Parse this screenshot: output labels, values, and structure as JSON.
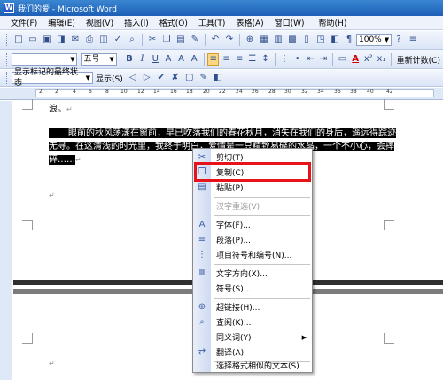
{
  "window": {
    "title": "我们的爱 - Microsoft Word",
    "app_icon": "word-icon"
  },
  "menu": [
    "文件(F)",
    "编辑(E)",
    "视图(V)",
    "插入(I)",
    "格式(O)",
    "工具(T)",
    "表格(A)",
    "窗口(W)",
    "帮助(H)"
  ],
  "toolbar1": {
    "zoom": "100%"
  },
  "toolbar2": {
    "font_size": "五号",
    "bold": "B",
    "italic": "I",
    "underline": "U",
    "font_color": "A",
    "superscript": "x²",
    "subscript": "x₁",
    "word_count": "重新计数(C)"
  },
  "toolbar3": {
    "view_mode": "显示标记的最终状态",
    "show": "显示(S)"
  },
  "ruler": {
    "ticks": [
      "2",
      "2",
      "4",
      "6",
      "8",
      "10",
      "12",
      "14",
      "16",
      "18",
      "20",
      "22",
      "24",
      "26",
      "28",
      "30",
      "32",
      "34",
      "36",
      "38",
      "40",
      "42"
    ]
  },
  "document": {
    "line0": "浪。",
    "line1": "眼前的秋风荡漾在窗前，早已吹落我们的春花秋月，消失在我们的身后，遥远得踪迹",
    "line2": "无寻。在这清浅的时光里，我终于明白，",
    "line2_tail": "爱情是一只精致易碎的水晶，一个不小心，会摔",
    "line3": "碎……"
  },
  "context_menu": {
    "items": [
      {
        "label": "剪切(T)",
        "icon": "scissors-icon"
      },
      {
        "label": "复制(C)",
        "icon": "copy-icon"
      },
      {
        "label": "粘贴(P)",
        "icon": "paste-icon"
      },
      {
        "label": "汉字重选(V)",
        "icon": ""
      },
      {
        "label": "字体(F)...",
        "icon": "font-icon"
      },
      {
        "label": "段落(P)...",
        "icon": "paragraph-icon"
      },
      {
        "label": "项目符号和编号(N)...",
        "icon": "bullets-icon"
      },
      {
        "label": "文字方向(X)...",
        "icon": "text-direction-icon"
      },
      {
        "label": "符号(S)...",
        "icon": ""
      },
      {
        "label": "超链接(H)...",
        "icon": "hyperlink-icon"
      },
      {
        "label": "查阅(K)...",
        "icon": "lookup-icon"
      },
      {
        "label": "同义词(Y)",
        "icon": ""
      },
      {
        "label": "翻译(A)",
        "icon": "translate-icon"
      },
      {
        "label": "选择格式相似的文本(S)",
        "icon": ""
      }
    ],
    "highlight_color": "#e8121a"
  }
}
